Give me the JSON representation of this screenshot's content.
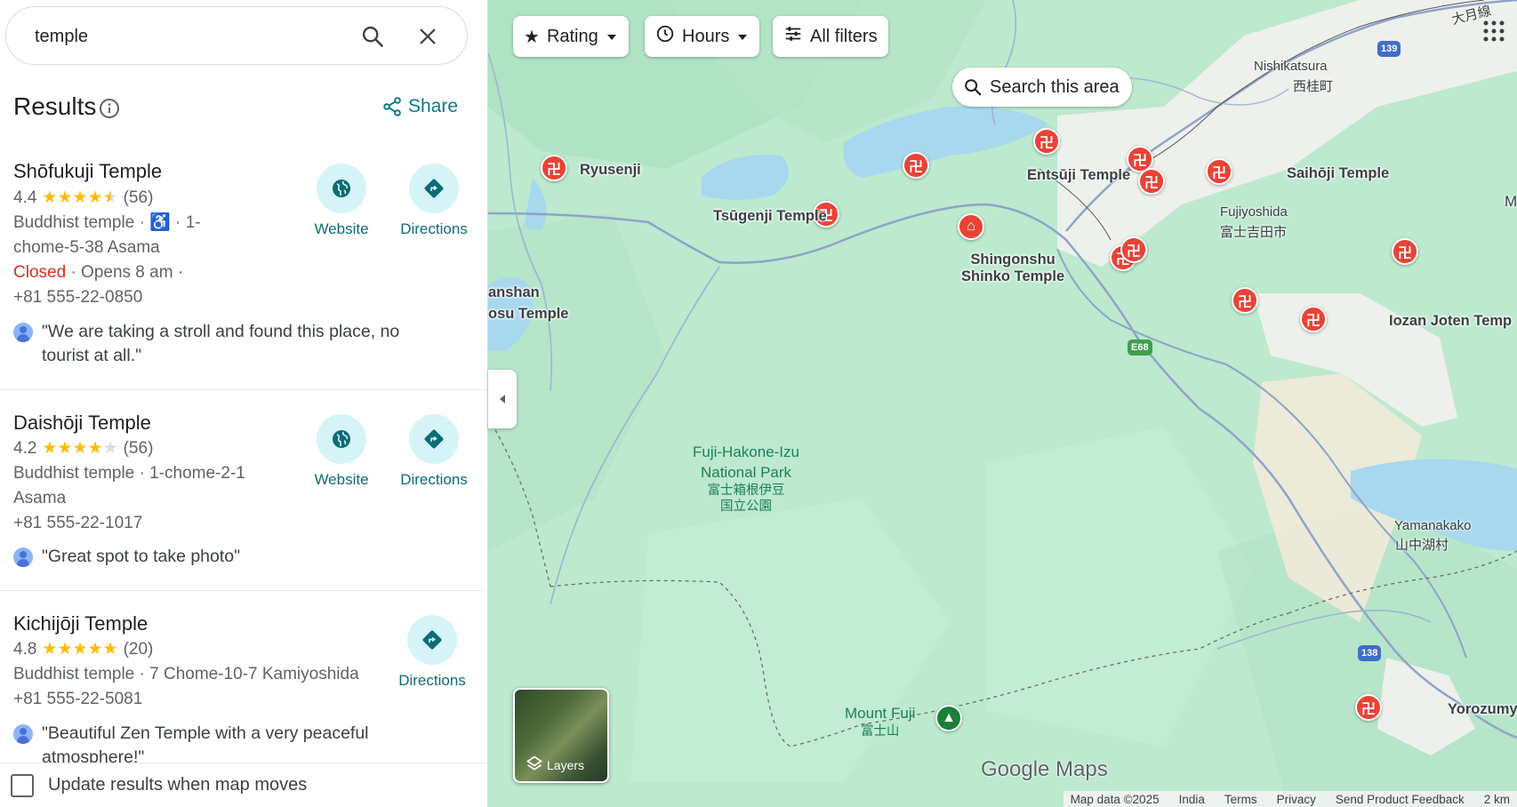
{
  "search": {
    "value": "temple"
  },
  "results": {
    "title": "Results",
    "share_label": "Share",
    "items": [
      {
        "name": "Shōfukuji Temple",
        "rating": "4.4",
        "stars_filled": 4.5,
        "reviews": "(56)",
        "type_line1": "Buddhist temple ·",
        "accessible_icon": "wheelchair-icon",
        "type_line1b": "· 1-",
        "address_line2": "chome-5-38 Asama",
        "status": "Closed",
        "hours": "· Opens 8 am ·",
        "phone": "+81 555-22-0850",
        "review": "\"We are taking a stroll and found this place, no tourist at all.\"",
        "website_label": "Website",
        "directions_label": "Directions"
      },
      {
        "name": "Daishōji Temple",
        "rating": "4.2",
        "stars_filled": 4,
        "reviews": "(56)",
        "type_line1": "Buddhist temple · 1-chome-2-1",
        "address_line2": "Asama",
        "phone": "+81 555-22-1017",
        "review": "\"Great spot to take photo\"",
        "website_label": "Website",
        "directions_label": "Directions"
      },
      {
        "name": "Kichijōji Temple",
        "rating": "4.8",
        "stars_filled": 5,
        "reviews": "(20)",
        "type_line1": "Buddhist temple · 7 Chome-10-7 Kamiyoshida",
        "phone": "+81 555-22-5081",
        "review": "\"Beautiful Zen Temple with a very peaceful atmosphere!\"",
        "directions_label": "Directions"
      }
    ]
  },
  "footer": {
    "update_label": "Update results when map moves",
    "update_checked": false
  },
  "map": {
    "filters": {
      "rating": "Rating",
      "hours": "Hours",
      "all": "All filters"
    },
    "search_area": "Search this area",
    "places": {
      "ryusenji": "Ryusenji",
      "tsugenji": "Tsūgenji Temple",
      "entsuji": "Entsūji Temple",
      "shingonshu_1": "Shingonshu",
      "shingonshu_2": "Shinko Temple",
      "saihoji": "Saihōji Temple",
      "iozan": "Iozan Joten Temp",
      "yorozumy": "Yorozumy",
      "anshan_1": "anshan",
      "anshan_2": "osu Temple"
    },
    "towns": {
      "nishikatsura": "Nishikatsura",
      "nishikatsura_jp": "西桂町",
      "fujiyoshida": "Fujiyoshida",
      "fujiyoshida_jp": "富士吉田市",
      "yamanakako": "Yamanakako",
      "yamanakako_jp": "山中湖村",
      "otsuki_line": "大月線"
    },
    "park": {
      "name1": "Fuji-Hakone-Izu",
      "name2": "National Park",
      "jp1": "富士箱根伊豆",
      "jp2": "国立公園"
    },
    "mountain": {
      "name": "Mount Fuji",
      "jp": "富士山"
    },
    "routes": {
      "r139": "139",
      "e68": "E68",
      "r138": "138"
    },
    "layers_label": "Layers",
    "logo": "Google Maps",
    "attribution": {
      "data": "Map data ©2025",
      "country": "India",
      "terms": "Terms",
      "privacy": "Privacy",
      "feedback": "Send Product Feedback",
      "scale": "2 km"
    },
    "colors": {
      "temple_pin": "#ea4335",
      "park_pin": "#188038",
      "water": "#a8d8ee",
      "accent": "#0b7885"
    }
  }
}
